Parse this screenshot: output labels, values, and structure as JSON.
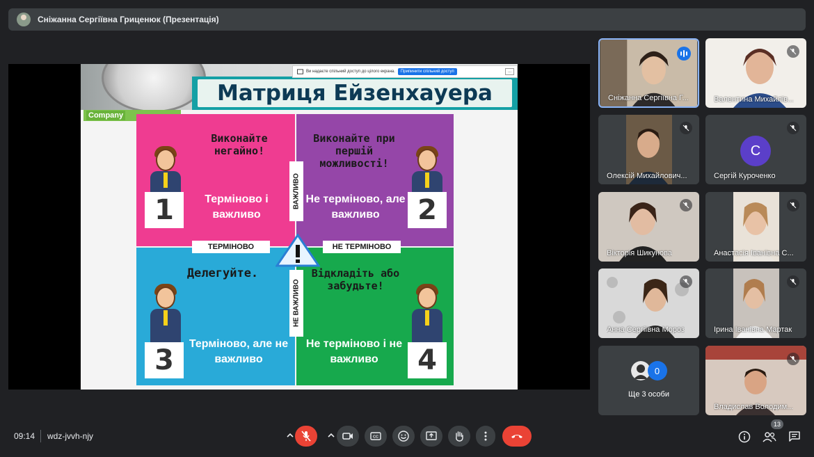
{
  "topbar": {
    "presenter_title": "Сніжанна Сергіївна Гриценюк (Презентація)"
  },
  "slide": {
    "title": "Матриця Ейзенхауера",
    "company": "Company",
    "share_bar": {
      "text": "Ви надаєте спільний доступ до цілого екрана.",
      "share_button": "Припинити спільний доступ",
      "hide_button": "..."
    },
    "quadrants": [
      {
        "heading": "Виконайте негайно!",
        "label": "Терміново і важливо",
        "number": "1"
      },
      {
        "heading": "Виконайте при першій можливості!",
        "label": "Не терміново, але важливо",
        "number": "2"
      },
      {
        "heading": "Делегуйте.",
        "label": "Терміново, але не важливо",
        "number": "3"
      },
      {
        "heading": "Відкладіть або забудьте!",
        "label": "Не терміново і не важливо",
        "number": "4"
      }
    ],
    "axis": {
      "left": "ТЕРМІНОВО",
      "right": "НЕ ТЕРМІНОВО",
      "up": "ВАЖЛИВО",
      "down": "НЕ ВАЖЛИВО"
    }
  },
  "participants": [
    {
      "name": "Сніжанна Сергіївна Г...",
      "speaking": true
    },
    {
      "name": "Валентина Михайлів..."
    },
    {
      "name": "Олексій Михайлович..."
    },
    {
      "name": "Сергій Куроченко",
      "initial": "С"
    },
    {
      "name": "Вікторія Шикунова"
    },
    {
      "name": "Анастасія Іванівна С..."
    },
    {
      "name": "Анна Сергіївна Мороз"
    },
    {
      "name": "Ірина Іванівна Мартак"
    },
    {
      "name": "Ще 3 особи",
      "count": "0"
    },
    {
      "name": "Владислав Володим..."
    }
  ],
  "bottom": {
    "time": "09:14",
    "meeting_code": "wdz-jvvh-njy",
    "people_count": "13"
  },
  "colors": {
    "hangup": "#ea4335",
    "accent": "#1a73e8"
  }
}
